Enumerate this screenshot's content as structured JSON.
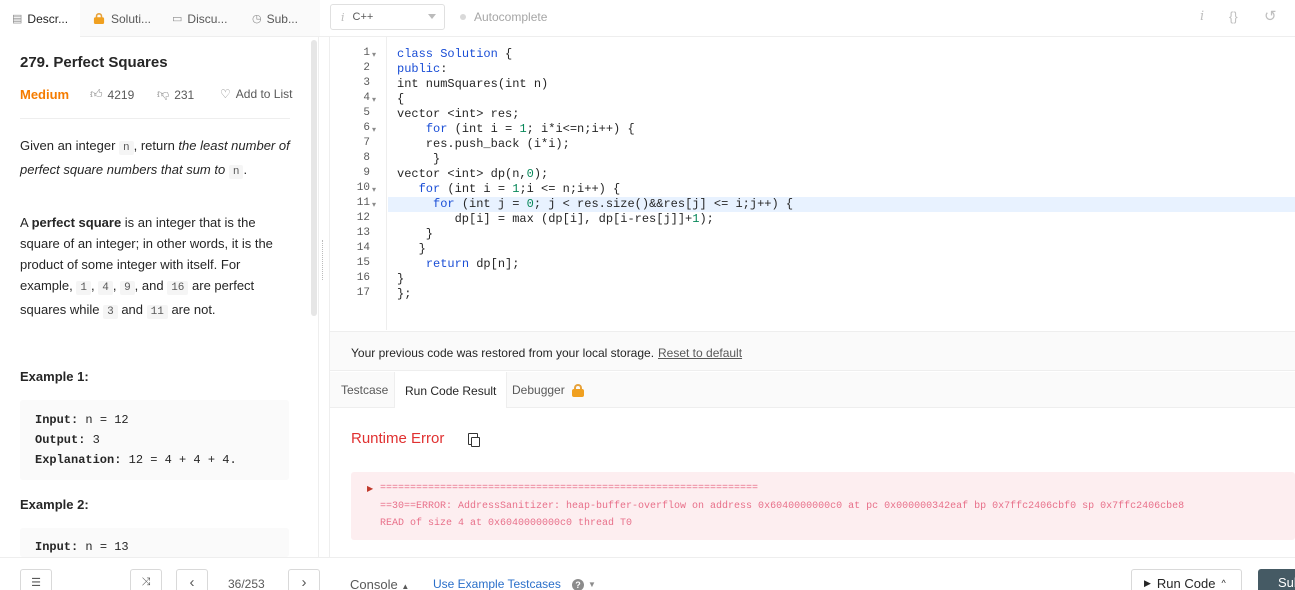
{
  "tabs": [
    {
      "label": "Descr...",
      "icon": "document-icon"
    },
    {
      "label": "Soluti...",
      "icon": "lock-icon"
    },
    {
      "label": "Discu...",
      "icon": "chat-icon"
    },
    {
      "label": "Sub...",
      "icon": "clock-icon"
    }
  ],
  "toolbar": {
    "language_icon": "i",
    "language": "C++",
    "autocomplete": "Autocomplete",
    "info_icon": "i",
    "braces_icon": "{}",
    "reset_icon": "↺"
  },
  "problem": {
    "title": "279. Perfect Squares",
    "difficulty": "Medium",
    "likes": "4219",
    "dislikes": "231",
    "add_to_list": "Add to List",
    "p1_a": "Given an integer ",
    "p1_code1": "n",
    "p1_b": ", return ",
    "p1_em": "the least number of perfect square numbers that sum to",
    "p1_c": " ",
    "p1_code2": "n",
    "p1_d": ".",
    "p2_a": "A ",
    "p2_bold": "perfect square",
    "p2_b": " is an integer that is the square of an integer; in other words, it is the product of some integer with itself. For example, ",
    "p2_c1": "1",
    "p2_sep1": ", ",
    "p2_c2": "4",
    "p2_sep2": ", ",
    "p2_c3": "9",
    "p2_sep3": ", and ",
    "p2_c4": "16",
    "p2_d": " are perfect squares while ",
    "p2_c5": "3",
    "p2_and": " and ",
    "p2_c6": "11",
    "p2_e": " are not.",
    "example1_title": "Example 1:",
    "example1_input_label": "Input:",
    "example1_input": " n = 12",
    "example1_output_label": "Output:",
    "example1_output": " 3",
    "example1_expl_label": "Explanation:",
    "example1_expl": " 12 = 4 + 4 + 4.",
    "example2_title": "Example 2:",
    "example2_input_label": "Input:",
    "example2_input": " n = 13"
  },
  "code": {
    "line_numbers": [
      "1",
      "2",
      "3",
      "4",
      "5",
      "6",
      "7",
      "8",
      "9",
      "10",
      "11",
      "12",
      "13",
      "14",
      "15",
      "16",
      "17"
    ],
    "lines": [
      "class Solution {",
      "public:",
      "int numSquares(int n)",
      "{",
      "vector <int> res;",
      "    for (int i = 1; i*i<=n;i++) {",
      "    res.push_back (i*i);",
      "     }",
      "vector <int> dp(n,0);",
      "   for (int i = 1;i <= n;i++) {",
      "     for (int j = 0; j < res.size()&&res[j] <= i;j++) {",
      "        dp[i] = max (dp[i], dp[i-res[j]]+1);",
      "    }",
      "   }",
      "    return dp[n];",
      "}",
      "};"
    ]
  },
  "restore": {
    "message": "Your previous code was restored from your local storage.",
    "reset_link": "Reset to default"
  },
  "result_tabs": [
    "Testcase",
    "Run Code Result",
    "Debugger"
  ],
  "result": {
    "status": "Runtime Error",
    "error_line1": "===============================================================",
    "error_line2": "==30==ERROR: AddressSanitizer: heap-buffer-overflow on address 0x6040000000c0 at pc 0x000000342eaf bp 0x7ffc2406cbf0 sp 0x7ffc2406cbe8",
    "error_line3": "READ of size 4 at 0x6040000000c0 thread T0"
  },
  "bottom": {
    "list_icon": "☰",
    "shuffle_icon": "⤨",
    "prev": "‹",
    "page": "36/253",
    "next": "›",
    "console": "Console",
    "use_example": "Use Example Testcases",
    "help": "?",
    "run_code": "Run Code",
    "submit": "Sub"
  },
  "colors": {
    "difficulty": "#f57c00",
    "error": "#e03131",
    "keyword": "#1a4ed6",
    "submit": "#455a64"
  }
}
